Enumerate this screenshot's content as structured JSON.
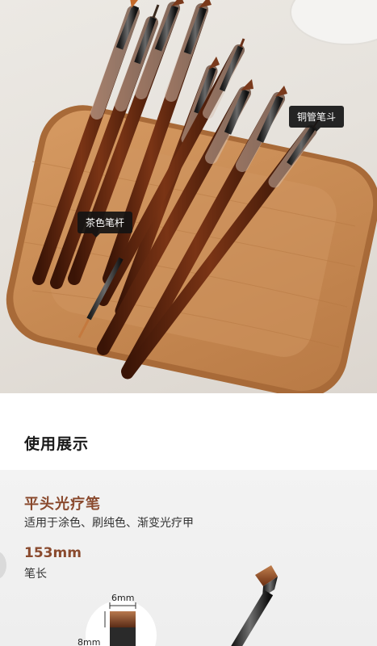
{
  "photo": {
    "tags": {
      "ferrule": "铜管笔斗",
      "handle": "茶色笔杆"
    }
  },
  "section": {
    "title": "使用展示"
  },
  "demo": {
    "name": "平头光疗笔",
    "usage": "适用于涂色、刷纯色、渐变光疗甲",
    "length_value": "153mm",
    "length_label": "笔长",
    "width_dim": "6mm",
    "height_dim": "8mm"
  },
  "colors": {
    "accent": "#8a4a2e",
    "handle": "#5a2410",
    "tray": "#c98a55"
  }
}
